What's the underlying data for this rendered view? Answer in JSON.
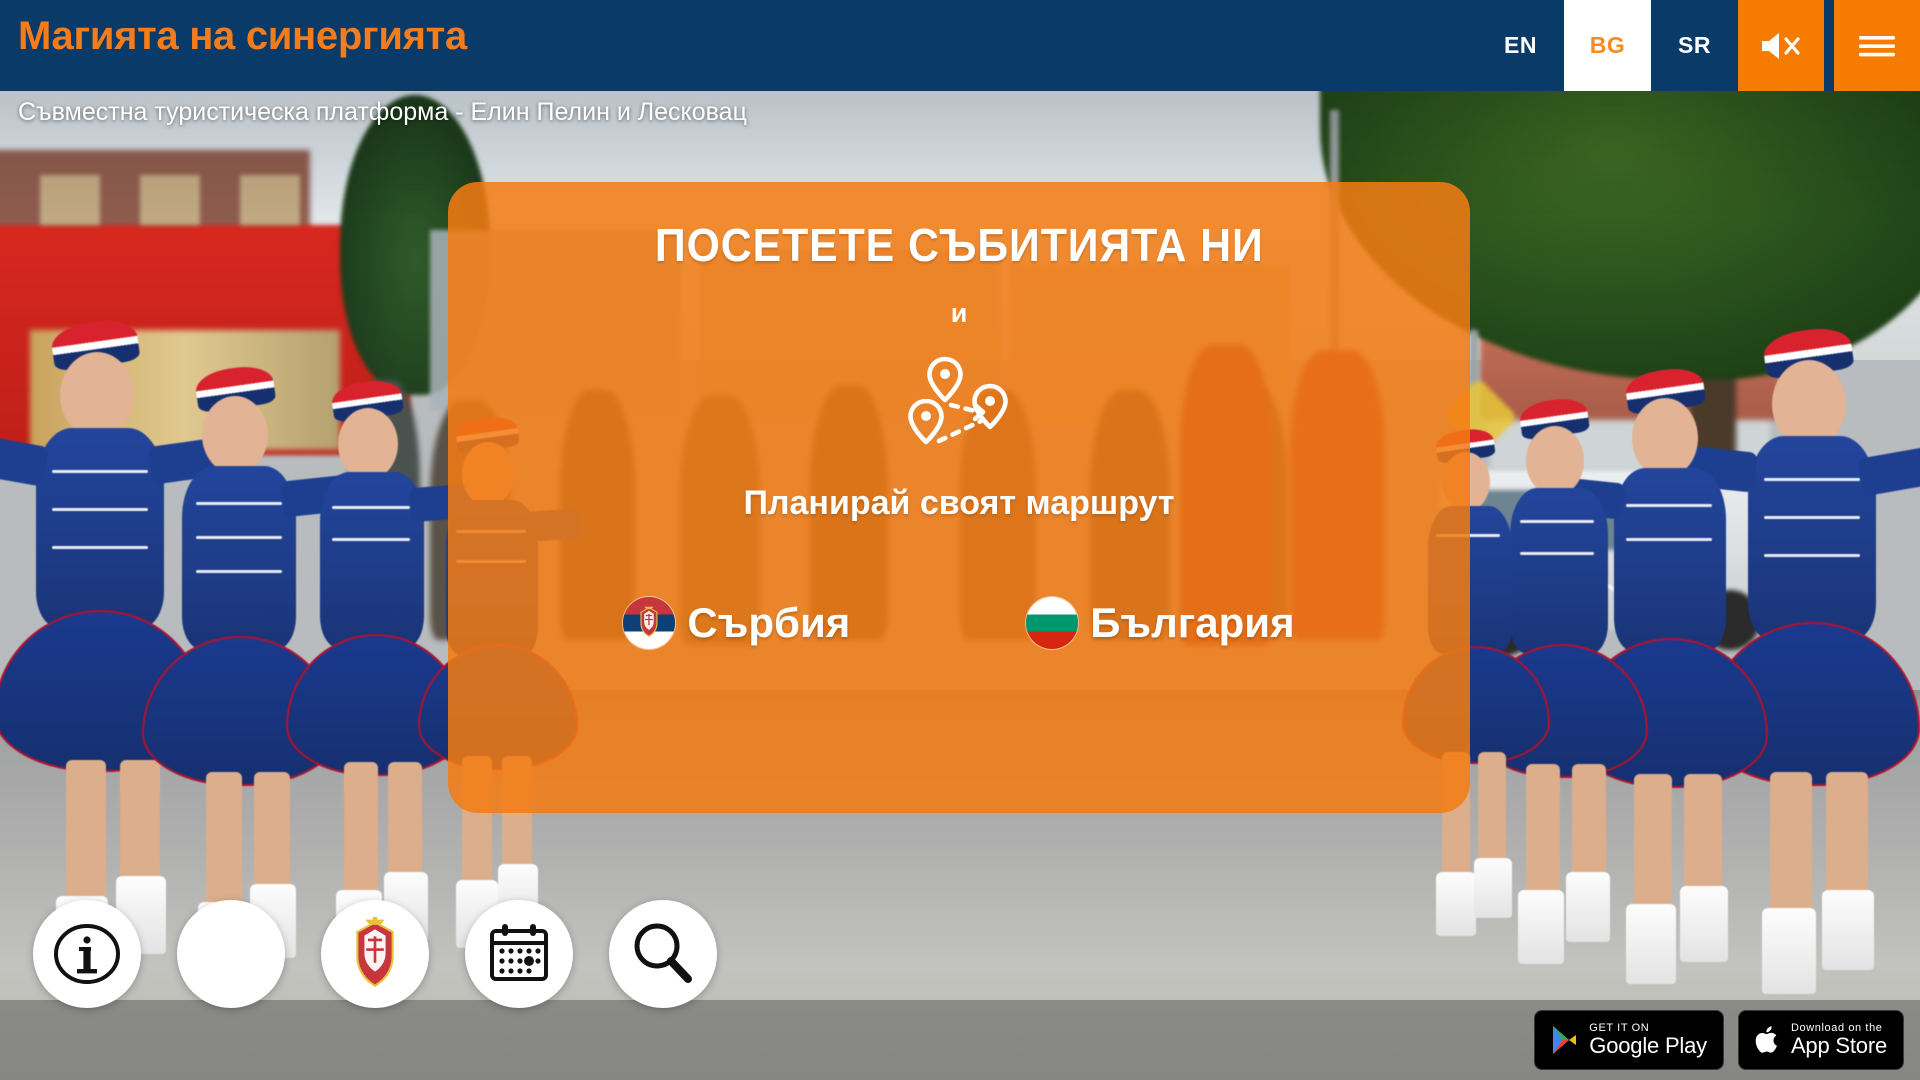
{
  "header": {
    "brand": "Магията на синергията",
    "languages": [
      {
        "code": "EN",
        "active": false
      },
      {
        "code": "BG",
        "active": true
      },
      {
        "code": "SR",
        "active": false
      }
    ],
    "sound_icon": "speaker-mute-icon",
    "menu_icon": "hamburger-menu-icon",
    "accent_color": "#f57c00",
    "bar_color": "#0a3a68"
  },
  "subtitle": "Съвместна туристическа платформа - Елин Пелин и Лесковац",
  "card": {
    "title": "ПОСЕТЕТЕ СЪБИТИЯТА НИ",
    "conjunction": "и",
    "route_icon": "map-route-pins-icon",
    "subtitle": "Планирай своят маршрут",
    "countries": [
      {
        "name": "Сърбия",
        "flag": "serbia-flag-icon"
      },
      {
        "name": "България",
        "flag": "bulgaria-flag-icon"
      }
    ],
    "background_color": "#f37c13"
  },
  "quick_buttons": [
    {
      "name": "info-button",
      "icon": "info-circle-icon",
      "label": "i"
    },
    {
      "name": "bulgaria-button",
      "icon": "bulgaria-flag-icon",
      "label": ""
    },
    {
      "name": "serbia-button",
      "icon": "serbia-flag-icon",
      "label": ""
    },
    {
      "name": "calendar-button",
      "icon": "calendar-icon",
      "label": ""
    },
    {
      "name": "search-button",
      "icon": "search-magnifier-icon",
      "label": ""
    }
  ],
  "stores": [
    {
      "small": "GET IT ON",
      "big": "Google Play",
      "icon": "google-play-icon"
    },
    {
      "small": "Download on the",
      "big": "App Store",
      "icon": "apple-logo-icon"
    }
  ],
  "background_photo": {
    "description": "Majorette dancers in blue uniforms marching in a street parade"
  }
}
